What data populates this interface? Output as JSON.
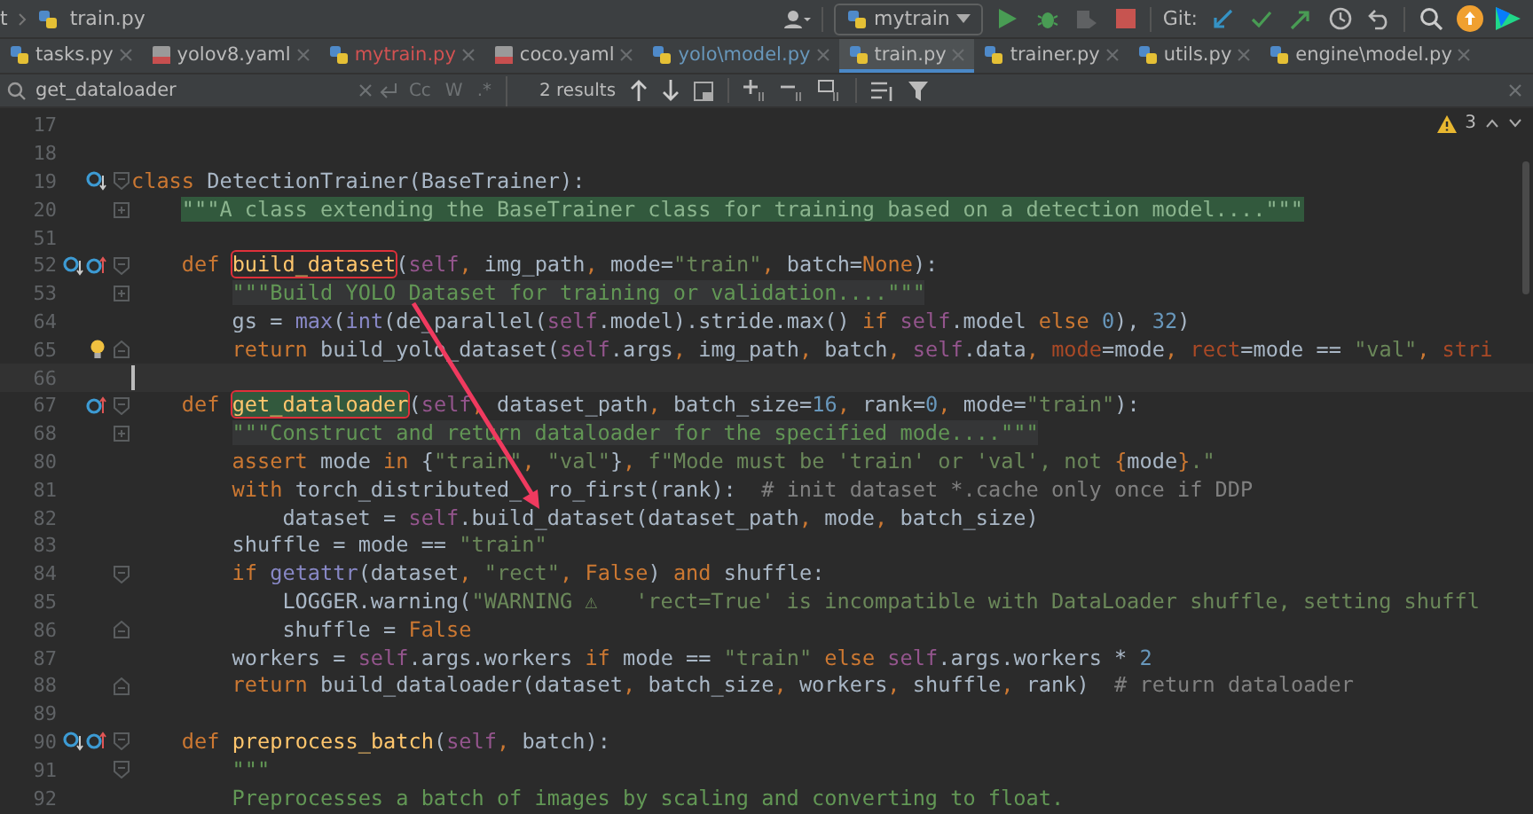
{
  "top_bar": {
    "breadcrumbs": [
      "t",
      "train.py"
    ],
    "run_config": "mytrain",
    "git_label": "Git:"
  },
  "tabs": [
    {
      "label": "tasks.py",
      "kind": "python",
      "color": "#bbbbbb",
      "selected": false
    },
    {
      "label": "yolov8.yaml",
      "kind": "yaml",
      "color": "#bbbbbb",
      "selected": false
    },
    {
      "label": "mytrain.py",
      "kind": "python",
      "color": "#d25252",
      "selected": false
    },
    {
      "label": "coco.yaml",
      "kind": "yaml",
      "color": "#bbbbbb",
      "selected": false
    },
    {
      "label": "yolo\\model.py",
      "kind": "python",
      "color": "#6897bb",
      "selected": false
    },
    {
      "label": "train.py",
      "kind": "python",
      "color": "#bbbbbb",
      "selected": true
    },
    {
      "label": "trainer.py",
      "kind": "python",
      "color": "#bbbbbb",
      "selected": false
    },
    {
      "label": "utils.py",
      "kind": "python",
      "color": "#bbbbbb",
      "selected": false
    },
    {
      "label": "engine\\model.py",
      "kind": "python",
      "color": "#bbbbbb",
      "selected": false
    }
  ],
  "search": {
    "value": "get_dataloader",
    "options": [
      {
        "label": "Cc",
        "selected": false
      },
      {
        "label": "W",
        "selected": false
      },
      {
        "label": ".*",
        "selected": false
      }
    ],
    "results": "2 results"
  },
  "warnings": "3",
  "lines": [
    {
      "number": "17",
      "current": false
    },
    {
      "number": "18",
      "current": false
    },
    {
      "number": "19",
      "current": false,
      "gutter": [
        {
          "kind": "override-down"
        }
      ],
      "fold": {
        "kind": "start"
      },
      "tokens": [
        {
          "kind": "keyword",
          "text": "class "
        },
        {
          "kind": "plain",
          "text": "DetectionTrainer(BaseTrainer):"
        }
      ],
      "children": [
        {
          "number": "20",
          "current": false,
          "fold": {
            "kind": "collapsed"
          },
          "tokens": [
            {
              "kind": "doc-found",
              "text": "\"\"\"A class extending the BaseTrainer class for training based on a detection model....\"\"\""
            }
          ]
        },
        {
          "number": "51",
          "current": false
        },
        {
          "number": "52",
          "current": false,
          "gutter": [
            {
              "kind": "override-down"
            },
            {
              "kind": "overridden-up"
            }
          ],
          "fold": {
            "kind": "start"
          },
          "tokens": [
            {
              "kind": "keyword",
              "text": "def "
            },
            {
              "kind": "funcname",
              "text": "build_dataset",
              "boxed": true,
              "search_match": false
            },
            {
              "kind": "plain",
              "text": "("
            },
            {
              "kind": "self",
              "text": "self"
            },
            {
              "kind": "punct",
              "text": ", "
            },
            {
              "kind": "plain",
              "text": "img_path"
            },
            {
              "kind": "punct",
              "text": ", "
            },
            {
              "kind": "plain",
              "text": "mode="
            },
            {
              "kind": "string",
              "text": "\"train\""
            },
            {
              "kind": "punct",
              "text": ", "
            },
            {
              "kind": "plain",
              "text": "batch="
            },
            {
              "kind": "keyword",
              "text": "None"
            },
            {
              "kind": "plain",
              "text": "):"
            }
          ],
          "children": [
            {
              "number": "53",
              "current": false,
              "fold": {
                "kind": "collapsed"
              },
              "tokens": [
                {
                  "kind": "doc",
                  "text": "\"\"\"Build YOLO Dataset for training or validation....\"\"\""
                }
              ]
            },
            {
              "number": "64",
              "current": false,
              "tokens": [
                {
                  "kind": "plain",
                  "text": "gs = "
                },
                {
                  "kind": "builtin",
                  "text": "max"
                },
                {
                  "kind": "plain",
                  "text": "("
                },
                {
                  "kind": "builtin",
                  "text": "int"
                },
                {
                  "kind": "plain",
                  "text": "(de_parallel("
                },
                {
                  "kind": "self",
                  "text": "self"
                },
                {
                  "kind": "plain",
                  "text": ".model).stride.max() "
                },
                {
                  "kind": "keyword",
                  "text": "if "
                },
                {
                  "kind": "self",
                  "text": "self"
                },
                {
                  "kind": "plain",
                  "text": ".model "
                },
                {
                  "kind": "keyword",
                  "text": "else "
                },
                {
                  "kind": "number",
                  "text": "0"
                },
                {
                  "kind": "plain",
                  "text": "), "
                },
                {
                  "kind": "number",
                  "text": "32"
                },
                {
                  "kind": "plain",
                  "text": ")"
                }
              ]
            },
            {
              "number": "65",
              "current": false,
              "gutter": [
                {
                  "kind": "bulb"
                }
              ],
              "fold": {
                "kind": "end"
              },
              "tokens": [
                {
                  "kind": "keyword",
                  "text": "return "
                },
                {
                  "kind": "plain",
                  "text": "build_yolo_dataset("
                },
                {
                  "kind": "self",
                  "text": "self"
                },
                {
                  "kind": "plain",
                  "text": ".args"
                },
                {
                  "kind": "punct",
                  "text": ", "
                },
                {
                  "kind": "plain",
                  "text": "img_path"
                },
                {
                  "kind": "punct",
                  "text": ", "
                },
                {
                  "kind": "plain",
                  "text": "batch"
                },
                {
                  "kind": "punct",
                  "text": ", "
                },
                {
                  "kind": "self",
                  "text": "self"
                },
                {
                  "kind": "plain",
                  "text": ".data"
                },
                {
                  "kind": "punct",
                  "text": ", "
                },
                {
                  "kind": "argname",
                  "text": "mode"
                },
                {
                  "kind": "plain",
                  "text": "=mode"
                },
                {
                  "kind": "punct",
                  "text": ", "
                },
                {
                  "kind": "argname",
                  "text": "rect"
                },
                {
                  "kind": "plain",
                  "text": "=mode == "
                },
                {
                  "kind": "string",
                  "text": "\"val\""
                },
                {
                  "kind": "punct",
                  "text": ", "
                },
                {
                  "kind": "argname",
                  "text": "stri"
                }
              ]
            }
          ]
        },
        {
          "number": "66",
          "current": true
        },
        {
          "number": "67",
          "current": false,
          "gutter": [
            {
              "kind": "overridden-up"
            }
          ],
          "fold": {
            "kind": "start"
          },
          "tokens": [
            {
              "kind": "keyword",
              "text": "def "
            },
            {
              "kind": "funcname",
              "text": "get_dataloader",
              "boxed": true,
              "search_match": true
            },
            {
              "kind": "plain",
              "text": "("
            },
            {
              "kind": "self",
              "text": "self"
            },
            {
              "kind": "punct",
              "text": ", "
            },
            {
              "kind": "plain",
              "text": "dataset_path"
            },
            {
              "kind": "punct",
              "text": ", "
            },
            {
              "kind": "plain",
              "text": "batch_size="
            },
            {
              "kind": "number",
              "text": "16"
            },
            {
              "kind": "punct",
              "text": ", "
            },
            {
              "kind": "plain",
              "text": "rank="
            },
            {
              "kind": "number",
              "text": "0"
            },
            {
              "kind": "punct",
              "text": ", "
            },
            {
              "kind": "plain",
              "text": "mode="
            },
            {
              "kind": "string",
              "text": "\"train\""
            },
            {
              "kind": "plain",
              "text": "):"
            }
          ],
          "children": [
            {
              "number": "68",
              "current": false,
              "fold": {
                "kind": "collapsed"
              },
              "tokens": [
                {
                  "kind": "doc",
                  "text": "\"\"\"Construct and return dataloader for the specified mode....\"\"\""
                }
              ]
            },
            {
              "number": "80",
              "current": false,
              "tokens": [
                {
                  "kind": "keyword",
                  "text": "assert"
                },
                {
                  "kind": "plain",
                  "text": " mode "
                },
                {
                  "kind": "keyword",
                  "text": "in"
                },
                {
                  "kind": "plain",
                  "text": " {"
                },
                {
                  "kind": "string",
                  "text": "\"train\""
                },
                {
                  "kind": "punct",
                  "text": ", "
                },
                {
                  "kind": "string",
                  "text": "\"val\""
                },
                {
                  "kind": "plain",
                  "text": "}"
                },
                {
                  "kind": "punct",
                  "text": ", "
                },
                {
                  "kind": "string",
                  "text": "f\"Mode must be 'train' or 'val', not "
                },
                {
                  "kind": "punct",
                  "text": "{"
                },
                {
                  "kind": "plain",
                  "text": "mode"
                },
                {
                  "kind": "punct",
                  "text": "}"
                },
                {
                  "kind": "string",
                  "text": ".\""
                }
              ]
            },
            {
              "number": "81",
              "current": false,
              "tokens": [
                {
                  "kind": "keyword",
                  "text": "with"
                },
                {
                  "kind": "plain",
                  "text": " torch_distributed_"
                },
                {
                  "kind": "covered"
                },
                {
                  "kind": "plain",
                  "text": "ro_first(rank):  "
                },
                {
                  "kind": "comment",
                  "text": "# init dataset *.cache only once if DDP"
                }
              ],
              "children": [
                {
                  "number": "82",
                  "current": false,
                  "tokens": [
                    {
                      "kind": "plain",
                      "text": "dataset = "
                    },
                    {
                      "kind": "self",
                      "text": "self"
                    },
                    {
                      "kind": "plain",
                      "text": ".build_dataset(dataset_path"
                    },
                    {
                      "kind": "punct",
                      "text": ", "
                    },
                    {
                      "kind": "plain",
                      "text": "mode"
                    },
                    {
                      "kind": "punct",
                      "text": ", "
                    },
                    {
                      "kind": "plain",
                      "text": "batch_size)"
                    }
                  ]
                }
              ]
            },
            {
              "number": "83",
              "current": false,
              "tokens": [
                {
                  "kind": "plain",
                  "text": "shuffle = mode == "
                },
                {
                  "kind": "string",
                  "text": "\"train\""
                }
              ]
            },
            {
              "number": "84",
              "current": false,
              "fold": {
                "kind": "start"
              },
              "tokens": [
                {
                  "kind": "keyword",
                  "text": "if "
                },
                {
                  "kind": "builtin",
                  "text": "getattr"
                },
                {
                  "kind": "plain",
                  "text": "(dataset"
                },
                {
                  "kind": "punct",
                  "text": ", "
                },
                {
                  "kind": "string",
                  "text": "\"rect\""
                },
                {
                  "kind": "punct",
                  "text": ", "
                },
                {
                  "kind": "keyword",
                  "text": "False"
                },
                {
                  "kind": "plain",
                  "text": ") "
                },
                {
                  "kind": "keyword",
                  "text": "and"
                },
                {
                  "kind": "plain",
                  "text": " shuffle:"
                }
              ],
              "children": [
                {
                  "number": "85",
                  "current": false,
                  "tokens": [
                    {
                      "kind": "plain",
                      "text": "LOGGER.warning("
                    },
                    {
                      "kind": "string",
                      "text": "\"WARNING ⚠   'rect=True' is incompatible with DataLoader shuffle, setting shuffl"
                    }
                  ]
                },
                {
                  "number": "86",
                  "current": false,
                  "fold": {
                    "kind": "end"
                  },
                  "tokens": [
                    {
                      "kind": "plain",
                      "text": "shuffle = "
                    },
                    {
                      "kind": "keyword",
                      "text": "False"
                    }
                  ]
                }
              ]
            },
            {
              "number": "87",
              "current": false,
              "tokens": [
                {
                  "kind": "plain",
                  "text": "workers = "
                },
                {
                  "kind": "self",
                  "text": "self"
                },
                {
                  "kind": "plain",
                  "text": ".args.workers "
                },
                {
                  "kind": "keyword",
                  "text": "if"
                },
                {
                  "kind": "plain",
                  "text": " mode == "
                },
                {
                  "kind": "string",
                  "text": "\"train\""
                },
                {
                  "kind": "keyword",
                  "text": " else "
                },
                {
                  "kind": "self",
                  "text": "self"
                },
                {
                  "kind": "plain",
                  "text": ".args.workers * "
                },
                {
                  "kind": "number",
                  "text": "2"
                }
              ]
            },
            {
              "number": "88",
              "current": false,
              "fold": {
                "kind": "end"
              },
              "tokens": [
                {
                  "kind": "keyword",
                  "text": "return"
                },
                {
                  "kind": "plain",
                  "text": " build_dataloader(dataset"
                },
                {
                  "kind": "punct",
                  "text": ", "
                },
                {
                  "kind": "plain",
                  "text": "batch_size"
                },
                {
                  "kind": "punct",
                  "text": ", "
                },
                {
                  "kind": "plain",
                  "text": "workers"
                },
                {
                  "kind": "punct",
                  "text": ", "
                },
                {
                  "kind": "plain",
                  "text": "shuffle"
                },
                {
                  "kind": "punct",
                  "text": ", "
                },
                {
                  "kind": "plain",
                  "text": "rank)  "
                },
                {
                  "kind": "comment",
                  "text": "# return dataloader"
                }
              ]
            }
          ]
        },
        {
          "number": "89",
          "current": false
        },
        {
          "number": "90",
          "current": false,
          "gutter": [
            {
              "kind": "override-down"
            },
            {
              "kind": "overridden-up"
            }
          ],
          "fold": {
            "kind": "start"
          },
          "tokens": [
            {
              "kind": "keyword",
              "text": "def "
            },
            {
              "kind": "funcname",
              "text": "preprocess_batch",
              "boxed": false,
              "search_match": false
            },
            {
              "kind": "plain",
              "text": "("
            },
            {
              "kind": "self",
              "text": "self"
            },
            {
              "kind": "punct",
              "text": ", "
            },
            {
              "kind": "plain",
              "text": "batch):"
            }
          ],
          "children": [
            {
              "number": "91",
              "current": false,
              "fold": {
                "kind": "start"
              },
              "tokens": [
                {
                  "kind": "docplain",
                  "text": "\"\"\""
                }
              ]
            },
            {
              "number": "92",
              "current": false,
              "tokens": [
                {
                  "kind": "docplain",
                  "text": "Preprocesses a batch of images by scaling and converting to float."
                }
              ]
            }
          ]
        }
      ]
    }
  ]
}
